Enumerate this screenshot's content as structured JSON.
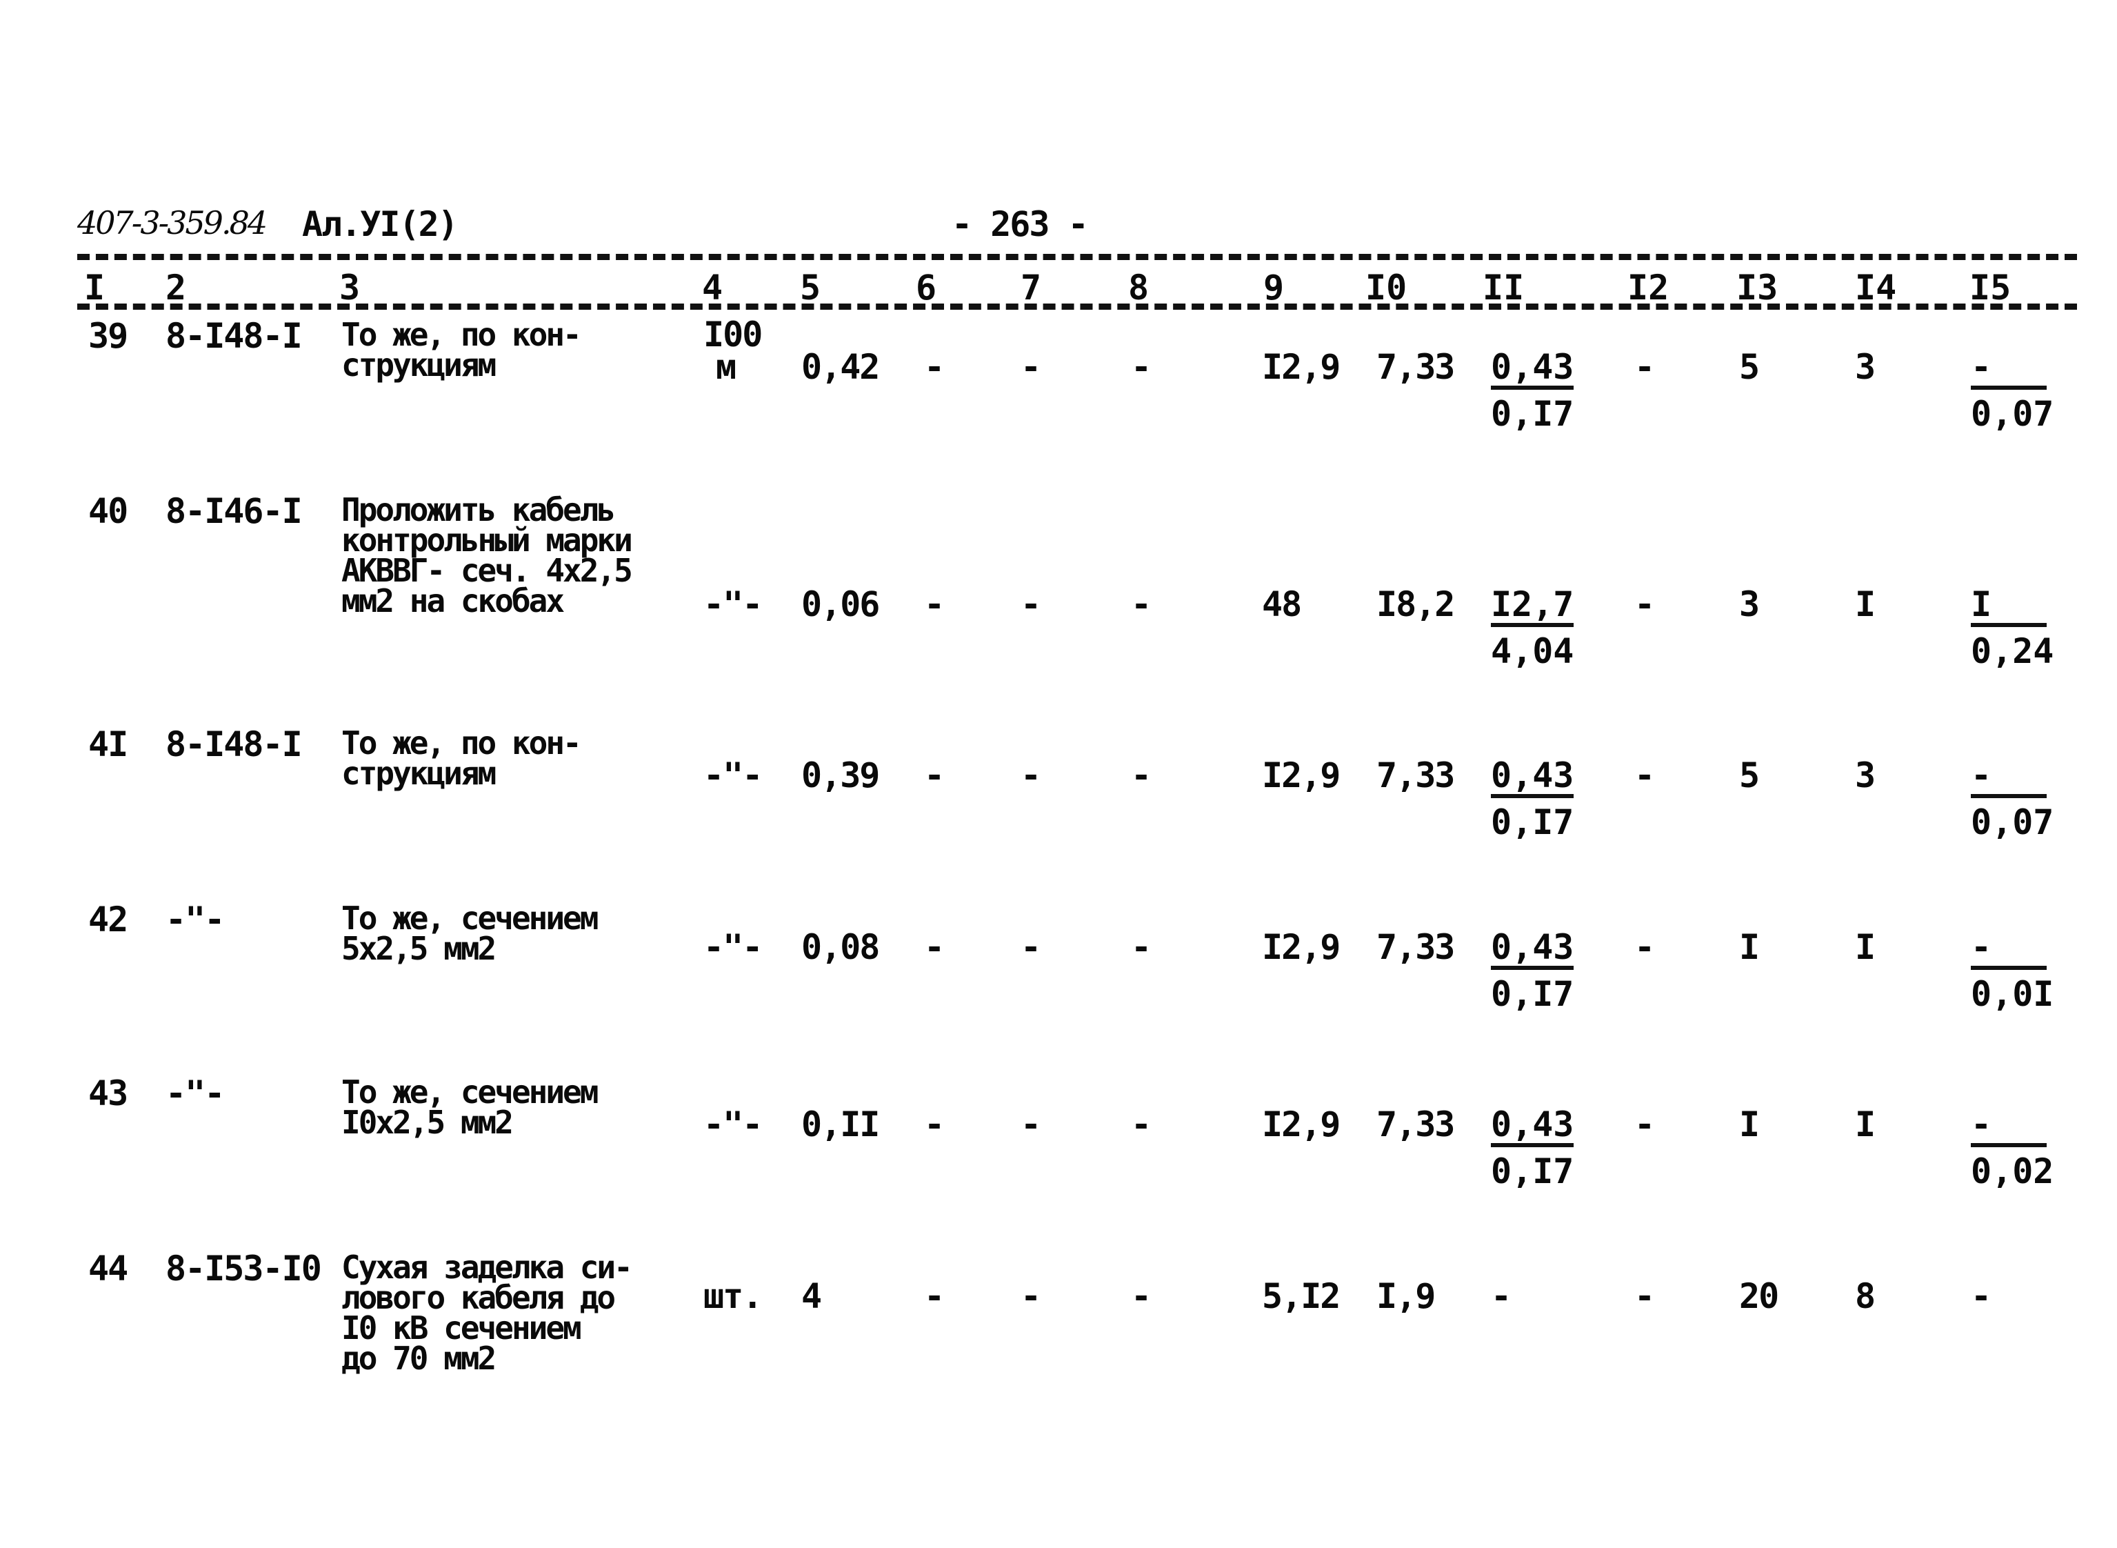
{
  "header": {
    "doc_code": "407-3-359.84",
    "album": "Ал.УI(2)",
    "page_number": "- 263 -"
  },
  "column_numbers": [
    "I",
    "2",
    "3",
    "4",
    "5",
    "6",
    "7",
    "8",
    "9",
    "I0",
    "II",
    "I2",
    "I3",
    "I4",
    "I5"
  ],
  "rows": [
    {
      "n": "39",
      "code": "8-I48-I",
      "desc": [
        "То же, по кон-",
        "струкциям"
      ],
      "unit": [
        "I00",
        "м"
      ],
      "c5": "0,42",
      "c6": "-",
      "c7": "-",
      "c8": "-",
      "c9": "I2,9",
      "c10": "7,33",
      "c11": {
        "num": "0,43",
        "den": "0,I7"
      },
      "c12": "-",
      "c13": "5",
      "c14": "3",
      "c15": {
        "num": "-",
        "den": "0,07"
      }
    },
    {
      "n": "40",
      "code": "8-I46-I",
      "desc": [
        "Проложить кабель",
        "контрольный марки",
        "АКВВГ- сеч. 4х2,5",
        "мм2 на скобах"
      ],
      "unit": [
        "-\"-"
      ],
      "c5": "0,06",
      "c6": "-",
      "c7": "-",
      "c8": "-",
      "c9": "48",
      "c10": "I8,2",
      "c11": {
        "num": "I2,7",
        "den": "4,04"
      },
      "c12": "-",
      "c13": "3",
      "c14": "I",
      "c15": {
        "num": "I",
        "den": "0,24"
      }
    },
    {
      "n": "4I",
      "code": "8-I48-I",
      "desc": [
        "То же, по кон-",
        "струкциям"
      ],
      "unit": [
        "-\"-"
      ],
      "c5": "0,39",
      "c6": "-",
      "c7": "-",
      "c8": "-",
      "c9": "I2,9",
      "c10": "7,33",
      "c11": {
        "num": "0,43",
        "den": "0,I7"
      },
      "c12": "-",
      "c13": "5",
      "c14": "3",
      "c15": {
        "num": "-",
        "den": "0,07"
      }
    },
    {
      "n": "42",
      "code": "-\"-",
      "desc": [
        "То же, сечением",
        "5х2,5 мм2"
      ],
      "unit": [
        "-\"-"
      ],
      "c5": "0,08",
      "c6": "-",
      "c7": "-",
      "c8": "-",
      "c9": "I2,9",
      "c10": "7,33",
      "c11": {
        "num": "0,43",
        "den": "0,I7"
      },
      "c12": "-",
      "c13": "I",
      "c14": "I",
      "c15": {
        "num": "-",
        "den": "0,0I"
      }
    },
    {
      "n": "43",
      "code": "-\"-",
      "desc": [
        "То же, сечением",
        "I0х2,5 мм2"
      ],
      "unit": [
        "-\"-"
      ],
      "c5": "0,II",
      "c6": "-",
      "c7": "-",
      "c8": "-",
      "c9": "I2,9",
      "c10": "7,33",
      "c11": {
        "num": "0,43",
        "den": "0,I7"
      },
      "c12": "-",
      "c13": "I",
      "c14": "I",
      "c15": {
        "num": "-",
        "den": "0,02"
      }
    },
    {
      "n": "44",
      "code": "8-I53-I0",
      "desc": [
        "Сухая заделка си-",
        "лового кабеля до",
        "I0 кВ сечением",
        "до 70 мм2"
      ],
      "unit": [
        "шт."
      ],
      "c5": "4",
      "c6": "-",
      "c7": "-",
      "c8": "-",
      "c9": "5,I2",
      "c10": "I,9",
      "c11": {
        "num": "-",
        "den": ""
      },
      "c12": "-",
      "c13": "20",
      "c14": "8",
      "c15": {
        "num": "-",
        "den": ""
      }
    }
  ]
}
